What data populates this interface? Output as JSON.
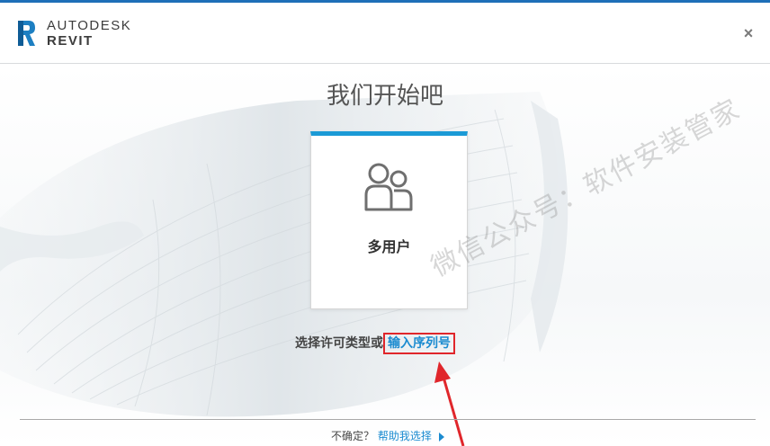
{
  "header": {
    "brand_line1": "AUTODESK",
    "brand_line2": "REVIT",
    "close_label": "×"
  },
  "main": {
    "title": "我们开始吧",
    "card": {
      "label": "多用户",
      "icon": "users-icon"
    },
    "prompt_text": "选择许可类型或",
    "serial_link": "输入序列号"
  },
  "footer": {
    "question": "不确定？",
    "help_link": "帮助我选择"
  },
  "watermark": "微信公众号：软件安装管家",
  "colors": {
    "accent": "#1b9ad6",
    "link": "#1b8bd0",
    "highlight_box": "#e0262b",
    "top_bar": "#1e6fb8"
  }
}
